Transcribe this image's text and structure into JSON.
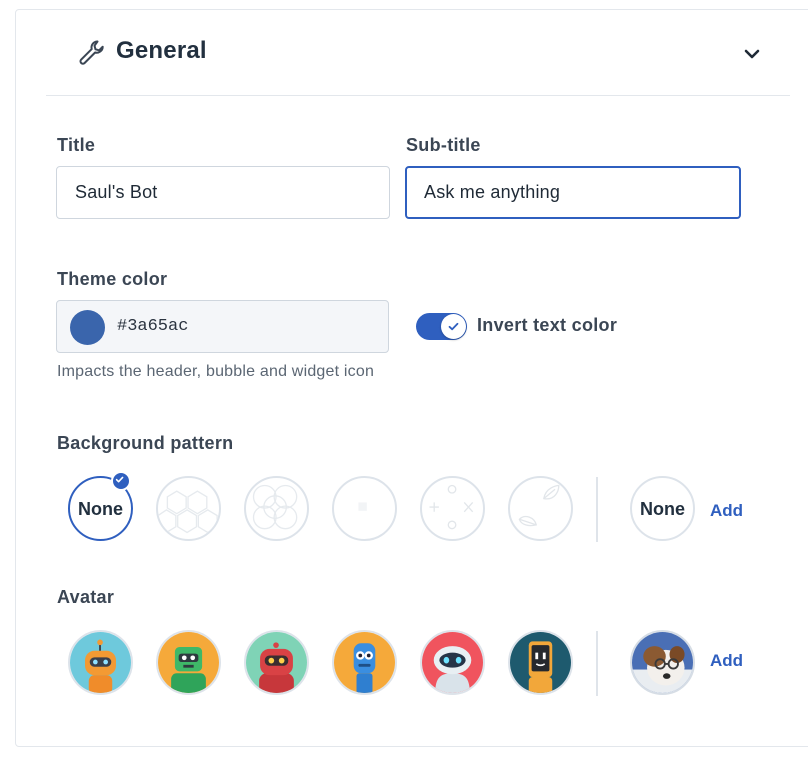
{
  "section": {
    "title": "General",
    "icon": "wrench-icon",
    "toggle_icon": "chevron-down-icon"
  },
  "fields": {
    "title": {
      "label": "Title",
      "value": "Saul's Bot"
    },
    "subtitle": {
      "label": "Sub-title",
      "value": "Ask me anything"
    }
  },
  "theme": {
    "label": "Theme color",
    "color": "#3a65ac",
    "help": "Impacts the header, bubble and widget icon",
    "invert_label": "Invert text color",
    "invert_on": true,
    "accent": "#2f5fbf"
  },
  "background": {
    "label": "Background pattern",
    "options": [
      {
        "name": "None",
        "selected": true
      },
      {
        "name": "hexagon-pattern"
      },
      {
        "name": "circle-lattice-pattern"
      },
      {
        "name": "square-dot-pattern"
      },
      {
        "name": "plus-cross-pattern"
      },
      {
        "name": "leaf-pattern"
      }
    ],
    "custom_label": "None",
    "add_label": "Add"
  },
  "avatar": {
    "label": "Avatar",
    "options": [
      {
        "name": "orange-robot-avatar",
        "bg": "#6ec9dc"
      },
      {
        "name": "green-robot-avatar",
        "bg": "#f5a93a"
      },
      {
        "name": "red-robot-avatar",
        "bg": "#7fd3b6"
      },
      {
        "name": "blue-robot-avatar",
        "bg": "#f5a93a"
      },
      {
        "name": "white-robot-avatar",
        "bg": "#f0545e"
      },
      {
        "name": "phone-robot-avatar",
        "bg": "#1e5a6e"
      }
    ],
    "custom": {
      "name": "dog-photo-avatar"
    },
    "add_label": "Add"
  }
}
